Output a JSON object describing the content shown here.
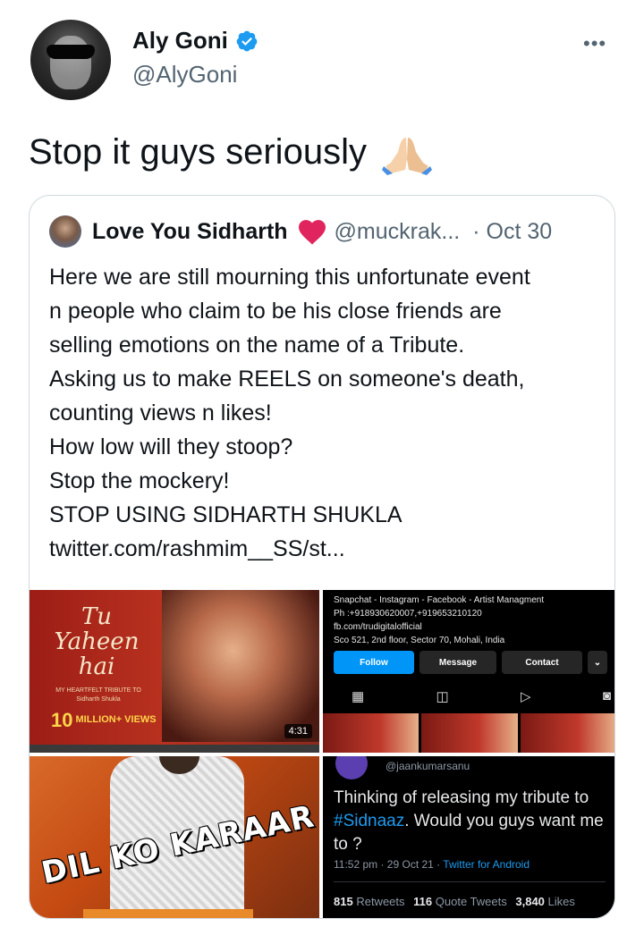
{
  "author": {
    "name": "Aly Goni",
    "handle": "@AlyGoni",
    "verified": true
  },
  "tweet_text": "Stop it guys seriously",
  "tweet_emoji": "folded-hands",
  "quoted": {
    "name": "Love You Sidharth",
    "handle": "@muckrak...",
    "separator": "·",
    "date": "Oct 30",
    "lines": [
      "Here we are still mourning this unfortunate event",
      "n people who claim to be his close friends are",
      "selling emotions on the name of a Tribute.",
      "Asking us to make REELS on someone's death,",
      "counting views n likes!",
      "How low will they stoop?",
      "Stop the mockery!",
      "STOP USING SIDHARTH SHUKLA",
      "twitter.com/rashmim__SS/st..."
    ],
    "media": {
      "video": {
        "title": "Tu Yaheen hai",
        "subtitle": "MY HEARTFELT TRIBUTE TO Sidharth Shukla",
        "views_number": "10",
        "views_label": "MILLION+ VIEWS",
        "duration": "4:31"
      },
      "instagram": {
        "info_lines": [
          "Snapchat - Instagram - Facebook - Artist Managment",
          "Ph :+918930620007,+919653210120",
          "fb.com/trudigitalofficial",
          "Sco 521, 2nd floor, Sector 70, Mohali, India"
        ],
        "follow": "Follow",
        "message": "Message",
        "contact": "Contact",
        "dropdown": "⌄"
      },
      "poster": {
        "title": "DIL KO KARAAR"
      },
      "screenshot_tweet": {
        "handle": "@jaankumarsanu",
        "text_before": "Thinking of releasing my tribute to ",
        "hashtag": "#Sidnaaz",
        "text_after": ". Would you guys want me to ?",
        "time": "11:52 pm · 29 Oct 21 · ",
        "source": "Twitter for Android",
        "retweets_count": "815",
        "retweets_label": "Retweets",
        "quotes_count": "116",
        "quotes_label": "Quote Tweets",
        "likes_count": "3,840",
        "likes_label": "Likes"
      }
    }
  },
  "colors": {
    "verified": "#1d9bf0",
    "heart": "#e0245e",
    "text_secondary": "#536471"
  }
}
